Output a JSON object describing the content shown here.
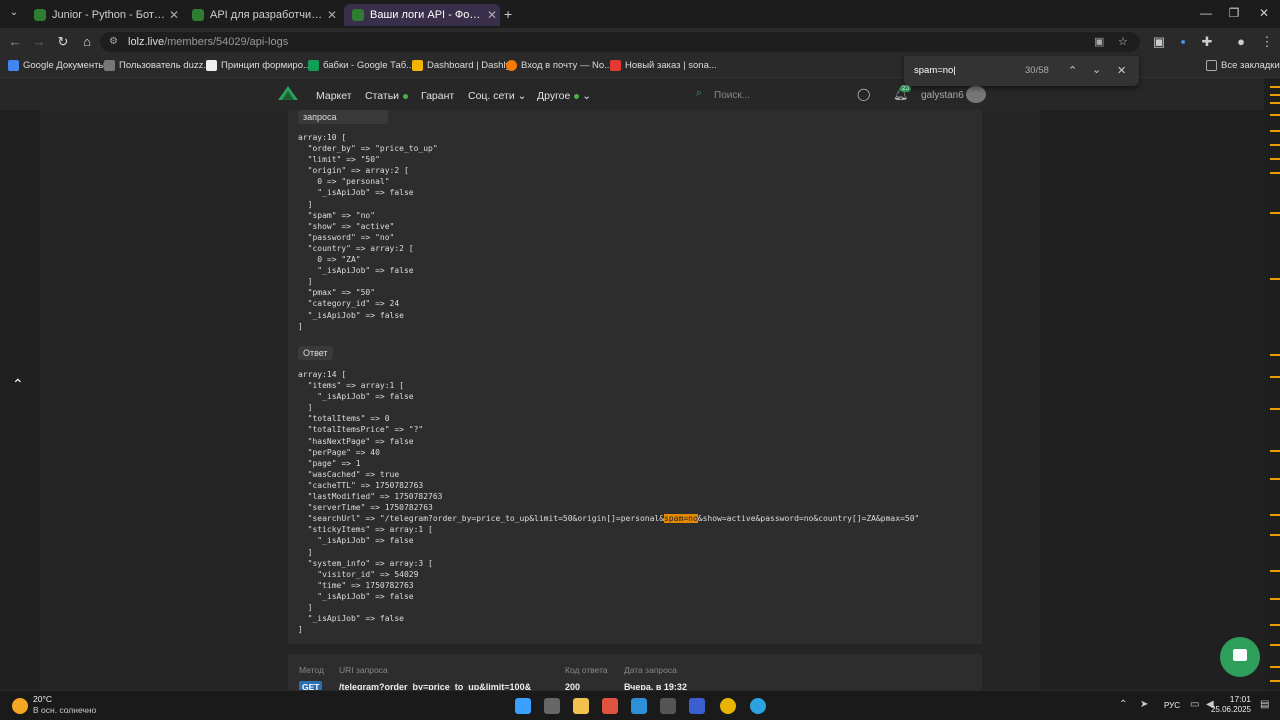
{
  "browser": {
    "tabs": [
      {
        "title": "Junior - Python - Бот - Софт - С",
        "active": false
      },
      {
        "title": "API для разработчика - Форум",
        "active": false
      },
      {
        "title": "Ваши логи API - Форум социа",
        "active": true
      }
    ],
    "url_host": "lolz.live",
    "url_path": "/members/54029/api-logs",
    "bookmarks": [
      {
        "label": "Google Документы",
        "color": "#4285f4"
      },
      {
        "label": "Пользователь duzz...",
        "color": "#777777"
      },
      {
        "label": "Принцип формиро...",
        "color": "#eeeeee"
      },
      {
        "label": "бабки - Google Таб...",
        "color": "#0f9d58"
      },
      {
        "label": "Dashboard | Dashly",
        "color": "#f4b400"
      },
      {
        "label": "Вход в почту — No...",
        "color": "#f57c00"
      },
      {
        "label": "Новый заказ | sona...",
        "color": "#e53935"
      }
    ],
    "all_bookmarks": "Все закладки",
    "find": {
      "query": "spam=no",
      "count": "30/58"
    }
  },
  "site": {
    "menu": [
      "Маркет",
      "Статьи",
      "Гарант",
      "Соц. сети",
      "Другое"
    ],
    "search_placeholder": "Поиск...",
    "notif_count": "23",
    "username": "galystan6"
  },
  "request_label": "запроса",
  "request_body": "array:10 [\n  \"order_by\" => \"price_to_up\"\n  \"limit\" => \"50\"\n  \"origin\" => array:2 [\n    0 => \"personal\"\n    \"_isApiJob\" => false\n  ]\n  \"spam\" => \"no\"\n  \"show\" => \"active\"\n  \"password\" => \"no\"\n  \"country\" => array:2 [\n    0 => \"ZA\"\n    \"_isApiJob\" => false\n  ]\n  \"pmax\" => \"50\"\n  \"category_id\" => 24\n  \"_isApiJob\" => false\n]",
  "response_label": "Ответ",
  "response_pre": "array:14 [\n  \"items\" => array:1 [\n    \"_isApiJob\" => false\n  ]\n  \"totalItems\" => 0\n  \"totalItemsPrice\" => \"?\"\n  \"hasNextPage\" => false\n  \"perPage\" => 40\n  \"page\" => 1\n  \"wasCached\" => true\n  \"cacheTTL\" => 1750782763\n  \"lastModified\" => 1750782763\n  \"serverTime\" => 1750782763\n  \"searchUrl\" => \"/telegram?order_by=price_to_up&limit=50&origin[]=personal&",
  "response_hl": "spam=no",
  "response_post": "&show=active&password=no&country[]=ZA&pmax=50\"\n  \"stickyItems\" => array:1 [\n    \"_isApiJob\" => false\n  ]\n  \"system_info\" => array:3 [\n    \"visitor_id\" => 54029\n    \"time\" => 1750782763\n    \"_isApiJob\" => false\n  ]\n  \"_isApiJob\" => false\n]",
  "logs_table": {
    "headers": [
      "Метод",
      "URI запроса",
      "Код ответа",
      "Дата запроса"
    ],
    "row": {
      "method": "GET",
      "uri": "/telegram?order_by=price_to_up&limit=100&",
      "code": "200",
      "date": "Вчера, в 19:32"
    }
  },
  "taskbar": {
    "weather_temp": "20°C",
    "weather_desc": "В осн. солнечно",
    "lang": "РУС",
    "time": "17:01",
    "date": "25.06.2025"
  }
}
